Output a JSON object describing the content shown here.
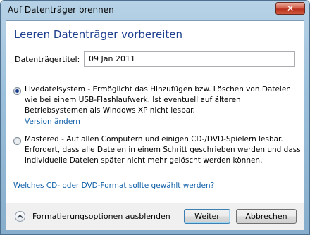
{
  "window": {
    "title": "Auf Datenträger brennen",
    "close_label": "✕"
  },
  "dialog": {
    "heading": "Leeren Datenträger vorbereiten",
    "disc_title_label": "Datenträgertitel:",
    "disc_title_value": "09 Jan 2011",
    "options": [
      {
        "selected": true,
        "text": "Livedateisystem - Ermöglicht das Hinzufügen bzw. Löschen von Dateien wie bei einem USB-Flashlaufwerk. Ist eventuell auf älteren Betriebsystemen als Windows XP nicht lesbar.",
        "link": "Version ändern"
      },
      {
        "selected": false,
        "text": "Mastered - Auf allen Computern und einigen CD-/DVD-Spielern lesbar. Erfordert, dass alle Dateien in einem Schritt geschrieben werden und dass individuelle Dateien später nicht mehr gelöscht werden können."
      }
    ],
    "help_link": "Welches CD- oder DVD-Format sollte gewählt werden?"
  },
  "footer": {
    "toggle_label": "Formatierungsoptionen ausblenden",
    "next_label": "Weiter",
    "cancel_label": "Abbrechen"
  },
  "colors": {
    "heading": "#1e3f8f",
    "link": "#0f5fa8",
    "close_button": "#c7402a",
    "default_button_border": "#3c7fb1"
  }
}
